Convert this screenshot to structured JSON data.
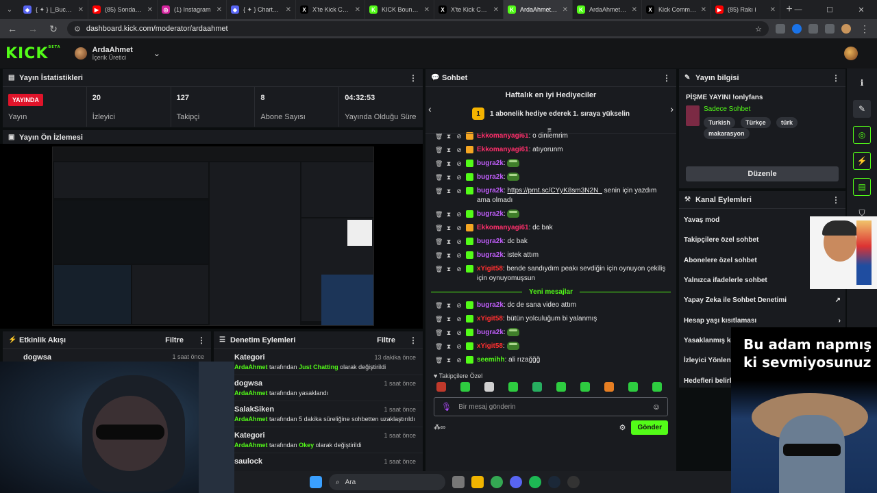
{
  "browser": {
    "tabs": [
      {
        "title": "{ ✦ } |_Bucketh",
        "fav_color": "#5865f2",
        "fav_char": "◆"
      },
      {
        "title": "(85) Sondaki h",
        "fav_color": "#ff0000",
        "fav_char": "▶"
      },
      {
        "title": "(1) Instagram",
        "fav_color": "#d6249f",
        "fav_char": "◎"
      },
      {
        "title": "{ ✦ } Charts - F",
        "fav_color": "#5865f2",
        "fav_char": "◆"
      },
      {
        "title": "X'te Kick Comm",
        "fav_color": "#000000",
        "fav_char": "X"
      },
      {
        "title": "KICK Bounties",
        "fav_color": "#53fc18",
        "fav_char": "K"
      },
      {
        "title": "X'te Kick Comm",
        "fav_color": "#000000",
        "fav_char": "X"
      },
      {
        "title": "ArdaAhmet Stre",
        "fav_color": "#53fc18",
        "fav_char": "K"
      },
      {
        "title": "ArdaAhmet Stre",
        "fav_color": "#53fc18",
        "fav_char": "K"
      },
      {
        "title": "Kick Communit",
        "fav_color": "#000000",
        "fav_char": "X"
      },
      {
        "title": "(85) Rakı i",
        "fav_color": "#ff0000",
        "fav_char": "▶"
      }
    ],
    "url": "dashboard.kick.com/moderator/ardaahmet"
  },
  "header": {
    "logo": "KICK",
    "logo_badge": "BETA",
    "username": "ArdaAhmet",
    "role": "İçerik Üretici"
  },
  "stats_panel": {
    "title": "Yayın İstatistikleri",
    "live_label": "YAYINDA",
    "stream_label": "Yayın",
    "items": [
      {
        "value": "20",
        "label": "İzleyici"
      },
      {
        "value": "127",
        "label": "Takipçi"
      },
      {
        "value": "8",
        "label": "Abone Sayısı"
      },
      {
        "value": "04:32:53",
        "label": "Yayında Olduğu Süre"
      }
    ]
  },
  "preview_panel": {
    "title": "Yayın Ön İzlemesi"
  },
  "activity_panel": {
    "title": "Etkinlik Akışı",
    "filter": "Filtre",
    "items": [
      {
        "name": "dogwsa",
        "when": "1 saat önce"
      }
    ]
  },
  "moderation_panel": {
    "title": "Denetim Eylemleri",
    "filter": "Filtre",
    "items": [
      {
        "title": "Kategori",
        "actor": "ArdaAhmet",
        "pre": "tarafından",
        "hl": "Just Chatting",
        "post": "olarak değiştirildi",
        "when": "13 dakika önce"
      },
      {
        "title": "dogwsa",
        "actor": "ArdaAhmet",
        "pre": "tarafından yasaklandı",
        "hl": "",
        "post": "",
        "when": "1 saat önce"
      },
      {
        "title": "SalakSiken",
        "actor": "ArdaAhmet",
        "pre": "tarafından 5 dakika süreliğine sohbetten uzaklaştırıldı",
        "hl": "",
        "post": "",
        "when": "1 saat önce"
      },
      {
        "title": "Kategori",
        "actor": "ArdaAhmet",
        "pre": "tarafından",
        "hl": "Okey",
        "post": "olarak değiştirildi",
        "when": "1 saat önce"
      },
      {
        "title": "saulock",
        "actor": "",
        "pre": "",
        "hl": "",
        "post": "",
        "when": "1 saat önce"
      }
    ]
  },
  "chat": {
    "title": "Sohbet",
    "gifters_title": "Haftalık en iyi Hediyeciler",
    "gifters_rank": "1",
    "gifters_text": "1 abonelik hediye ederek 1. sıraya yükselin",
    "new_messages": "Yeni mesajlar",
    "messages_before": [
      {
        "user": "Ekkomanyagi61",
        "color": "#ff2f6b",
        "text": "o dinlemrim",
        "emote": false,
        "link": ""
      },
      {
        "user": "Ekkomanyagi61",
        "color": "#ff2f6b",
        "text": "atıyorunm",
        "emote": false,
        "link": ""
      },
      {
        "user": "bugra2k",
        "color": "#c45fff",
        "text": "",
        "emote": true,
        "link": ""
      },
      {
        "user": "bugra2k",
        "color": "#c45fff",
        "text": "",
        "emote": true,
        "link": ""
      },
      {
        "user": "bugra2k",
        "color": "#c45fff",
        "text": "senin için yazdım ama olmadı",
        "emote": false,
        "link": "https://prnt.sc/CYyK8sm3N2N_"
      },
      {
        "user": "bugra2k",
        "color": "#c45fff",
        "text": "",
        "emote": true,
        "link": ""
      },
      {
        "user": "Ekkomanyagi61",
        "color": "#ff2f6b",
        "text": "dc bak",
        "emote": false,
        "link": ""
      },
      {
        "user": "bugra2k",
        "color": "#c45fff",
        "text": "dc bak",
        "emote": false,
        "link": ""
      },
      {
        "user": "bugra2k",
        "color": "#c45fff",
        "text": "istek attım",
        "emote": false,
        "link": ""
      },
      {
        "user": "xYigit58",
        "color": "#ff2f2f",
        "text": "bende sandıydım peakı sevdiğin için oynuyon çekiliş için oynuyomuşsun",
        "emote": false,
        "link": ""
      }
    ],
    "messages_after": [
      {
        "user": "bugra2k",
        "color": "#c45fff",
        "text": "dc de sana video attım",
        "emote": false,
        "link": ""
      },
      {
        "user": "xYigit58",
        "color": "#ff2f2f",
        "text": "bütün yolculuğum bi yalanmış",
        "emote": false,
        "link": ""
      },
      {
        "user": "bugra2k",
        "color": "#c45fff",
        "text": "",
        "emote": true,
        "link": ""
      },
      {
        "user": "xYigit58",
        "color": "#ff2f2f",
        "text": "",
        "emote": true,
        "link": ""
      },
      {
        "user": "seemihh",
        "color": "#53fc18",
        "text": "ali rızağğğ",
        "emote": false,
        "link": ""
      }
    ],
    "followers_only": "Takipçilere Özel",
    "input_placeholder": "Bir mesaj gönderin",
    "send_label": "Gönder"
  },
  "info_panel": {
    "title": "Yayın bilgisi",
    "stream_title": "PİŞME YAYINI !onlyfans",
    "category": "Sadece Sohbet",
    "tags": [
      "Turkish",
      "Türkçe",
      "türk",
      "makarasyon"
    ],
    "edit_label": "Düzenle"
  },
  "channel_actions": {
    "title": "Kanal Eylemleri",
    "items": [
      "Yavaş mod",
      "Takipçilere özel sohbet",
      "Abonelere özel sohbet",
      "Yalnızca ifadelerle sohbet",
      "Yapay Zeka ile Sohbet Denetimi",
      "Hesap yaşı kısıtlaması",
      "Yasaklanmış ke",
      "İzleyici Yönlend",
      "Hedefleri belirle"
    ]
  },
  "overlay": {
    "caption": "Bu adam napmış ki sevmiyosunuz"
  },
  "taskbar": {
    "search_placeholder": "Ara"
  },
  "colors": {
    "accent": "#53fc18",
    "live": "#e0142a",
    "panel": "#191b1f",
    "background": "#0b0e0f"
  }
}
